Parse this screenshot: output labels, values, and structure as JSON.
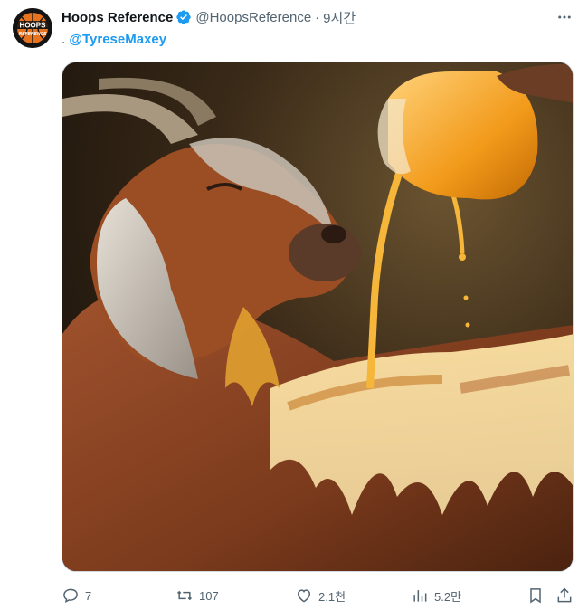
{
  "tweet": {
    "author": {
      "display_name": "Hoops Reference",
      "handle": "@HoopsReference",
      "verified": true,
      "avatar_text": "HOOPS REFERENCE"
    },
    "separator": "·",
    "time": "9시간",
    "text_prefix": ". ",
    "mention": "@TyreseMaxey",
    "media": {
      "description_icon": "goat-honey-image"
    },
    "actions": {
      "replies": "7",
      "retweets": "107",
      "likes": "2.1천",
      "views": "5.2만"
    }
  },
  "colors": {
    "accent": "#1d9bf0",
    "text_primary": "#0f1419",
    "text_secondary": "#536471"
  }
}
